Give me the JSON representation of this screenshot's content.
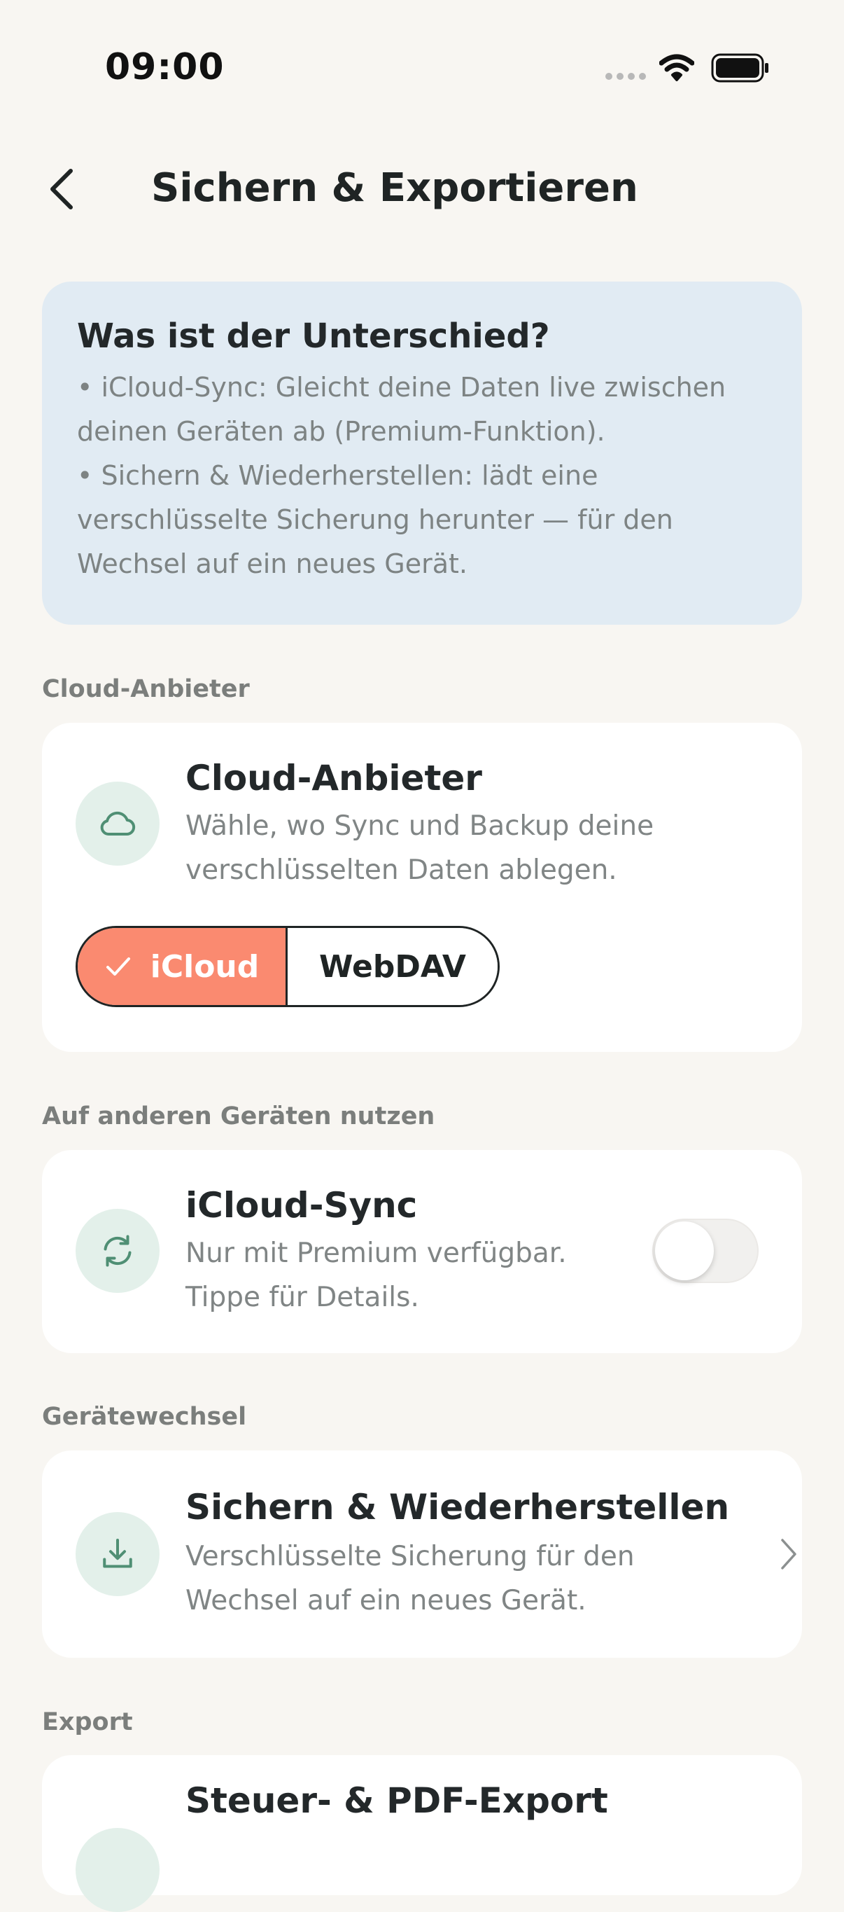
{
  "status_bar": {
    "time": "09:00"
  },
  "header": {
    "title": "Sichern & Exportieren",
    "back_icon": "chevron-left-icon"
  },
  "info": {
    "title": "Was ist der Unterschied?",
    "lines": [
      "• iCloud-Sync: Gleicht deine Daten live zwischen",
      "deinen Geräten ab (Premium-Funktion).",
      "• Sichern & Wiederherstellen: lädt eine",
      "verschlüsselte Sicherung herunter — für den",
      "Wechsel auf ein neues Gerät."
    ]
  },
  "sections": {
    "cloud": {
      "label": "Cloud-Anbieter",
      "card_title": "Cloud-Anbieter",
      "desc_lines": [
        "Wähle, wo Sync und Backup deine",
        "verschlüsselten Daten ablegen."
      ],
      "icon": "cloud-icon",
      "options": [
        {
          "label": "iCloud",
          "selected": true
        },
        {
          "label": "WebDAV",
          "selected": false
        }
      ]
    },
    "devices": {
      "label": "Auf anderen Geräten nutzen",
      "card_title": "iCloud-Sync",
      "desc_lines": [
        "Nur mit Premium verfügbar.",
        "Tippe für Details."
      ],
      "icon": "sync-icon",
      "toggle_on": false
    },
    "device_change": {
      "label": "Gerätewechsel",
      "card_title": "Sichern & Wiederherstellen",
      "desc_lines": [
        "Verschlüsselte Sicherung für den",
        "Wechsel auf ein neues Gerät."
      ],
      "icon": "download-icon"
    },
    "export": {
      "label": "Export",
      "card_title": "Steuer- & PDF-Export"
    }
  },
  "colors": {
    "background": "#f8f6f2",
    "info_card": "#e1ebf3",
    "accent": "#fa8a70",
    "icon_circle": "#e3f0ea",
    "icon_stroke": "#4f8f74"
  }
}
